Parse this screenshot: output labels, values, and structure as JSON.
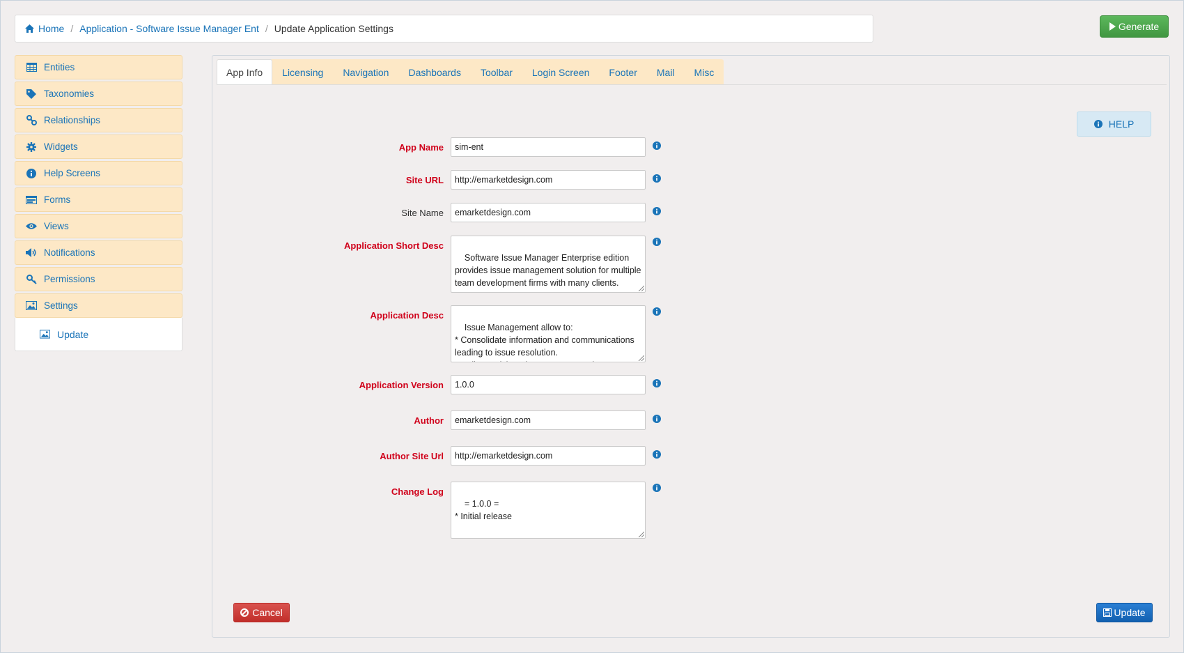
{
  "breadcrumb": {
    "home": "Home",
    "application": "Application - Software Issue Manager Ent",
    "current": "Update Application Settings"
  },
  "toolbar": {
    "generate_label": "Generate"
  },
  "sidebar": {
    "items": [
      {
        "label": "Entities",
        "icon": "table-icon"
      },
      {
        "label": "Taxonomies",
        "icon": "tag-icon"
      },
      {
        "label": "Relationships",
        "icon": "link-icon"
      },
      {
        "label": "Widgets",
        "icon": "gear-icon"
      },
      {
        "label": "Help Screens",
        "icon": "info-icon"
      },
      {
        "label": "Forms",
        "icon": "form-icon"
      },
      {
        "label": "Views",
        "icon": "eye-icon"
      },
      {
        "label": "Notifications",
        "icon": "speaker-icon"
      },
      {
        "label": "Permissions",
        "icon": "key-icon"
      },
      {
        "label": "Settings",
        "icon": "picture-icon"
      }
    ],
    "sub_item": {
      "label": "Update",
      "icon": "picture-icon"
    }
  },
  "tabs": [
    {
      "label": "App Info",
      "active": true
    },
    {
      "label": "Licensing"
    },
    {
      "label": "Navigation"
    },
    {
      "label": "Dashboards"
    },
    {
      "label": "Toolbar"
    },
    {
      "label": "Login Screen"
    },
    {
      "label": "Footer"
    },
    {
      "label": "Mail"
    },
    {
      "label": "Misc"
    }
  ],
  "help_label": "HELP",
  "form": {
    "app_name": {
      "label": "App Name",
      "value": "sim-ent",
      "required": true
    },
    "site_url": {
      "label": "Site URL",
      "value": "http://emarketdesign.com",
      "required": true
    },
    "site_name": {
      "label": "Site Name",
      "value": "emarketdesign.com",
      "required": false
    },
    "short_desc": {
      "label": "Application Short Desc",
      "value": "Software Issue Manager Enterprise edition provides issue management solution for multiple team development firms with many clients.",
      "required": true
    },
    "app_desc": {
      "label": "Application Desc",
      "value": "Issue Management allow to:\n* Consolidate information and communications leading to issue resolution.\n* Deliver quick and easy access to the",
      "required": true
    },
    "app_version": {
      "label": "Application Version",
      "value": "1.0.0",
      "required": true
    },
    "author": {
      "label": "Author",
      "value": "emarketdesign.com",
      "required": true
    },
    "author_url": {
      "label": "Author Site Url",
      "value": "http://emarketdesign.com",
      "required": true
    },
    "change_log": {
      "label": "Change Log",
      "value": "= 1.0.0 =\n* Initial release",
      "required": true
    }
  },
  "actions": {
    "cancel_label": "Cancel",
    "update_label": "Update"
  },
  "colors": {
    "required_label": "#d0021b",
    "link": "#1a74b8",
    "sidebar_bg": "#fde8c6",
    "generate": "#5cb85c",
    "cancel": "#d9534f",
    "update": "#1a6fc4"
  }
}
